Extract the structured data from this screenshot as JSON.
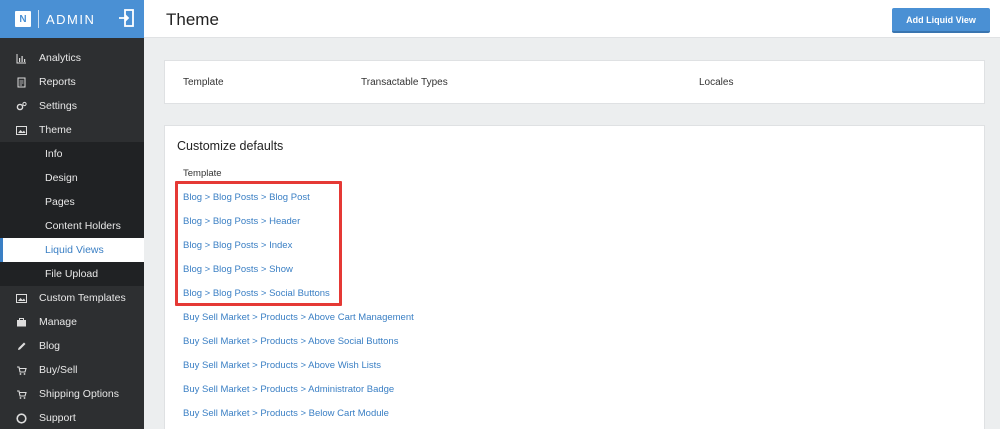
{
  "brand": {
    "logo_letter": "N",
    "name": "ADMIN"
  },
  "colors": {
    "accent": "#4a90d4",
    "sidebar_bg": "#2d2f31",
    "link": "#3a7fc4",
    "highlight": "#e53935"
  },
  "sidebar": {
    "items": [
      {
        "label": "Analytics",
        "icon": "chart-icon"
      },
      {
        "label": "Reports",
        "icon": "report-icon"
      },
      {
        "label": "Settings",
        "icon": "gear-icon"
      },
      {
        "label": "Theme",
        "icon": "image-icon"
      }
    ],
    "theme_subitems": [
      {
        "label": "Info"
      },
      {
        "label": "Design"
      },
      {
        "label": "Pages"
      },
      {
        "label": "Content Holders"
      },
      {
        "label": "Liquid Views",
        "active": true
      },
      {
        "label": "File Upload"
      }
    ],
    "items_after": [
      {
        "label": "Custom Templates",
        "icon": "image-icon"
      },
      {
        "label": "Manage",
        "icon": "briefcase-icon"
      },
      {
        "label": "Blog",
        "icon": "pencil-icon"
      },
      {
        "label": "Buy/Sell",
        "icon": "cart-icon"
      },
      {
        "label": "Shipping Options",
        "icon": "cart-icon"
      },
      {
        "label": "Support",
        "icon": "lifebuoy-icon"
      }
    ]
  },
  "header": {
    "title": "Theme",
    "add_button_label": "Add Liquid View"
  },
  "table_header": {
    "columns": [
      "Template",
      "Transactable Types",
      "Locales"
    ]
  },
  "customize": {
    "title": "Customize defaults",
    "template_label": "Template",
    "links": [
      "Blog > Blog Posts > Blog Post",
      "Blog > Blog Posts > Header",
      "Blog > Blog Posts > Index",
      "Blog > Blog Posts > Show",
      "Blog > Blog Posts > Social Buttons",
      "Buy Sell Market > Products > Above Cart Management",
      "Buy Sell Market > Products > Above Social Buttons",
      "Buy Sell Market > Products > Above Wish Lists",
      "Buy Sell Market > Products > Administrator Badge",
      "Buy Sell Market > Products > Below Cart Module"
    ]
  }
}
